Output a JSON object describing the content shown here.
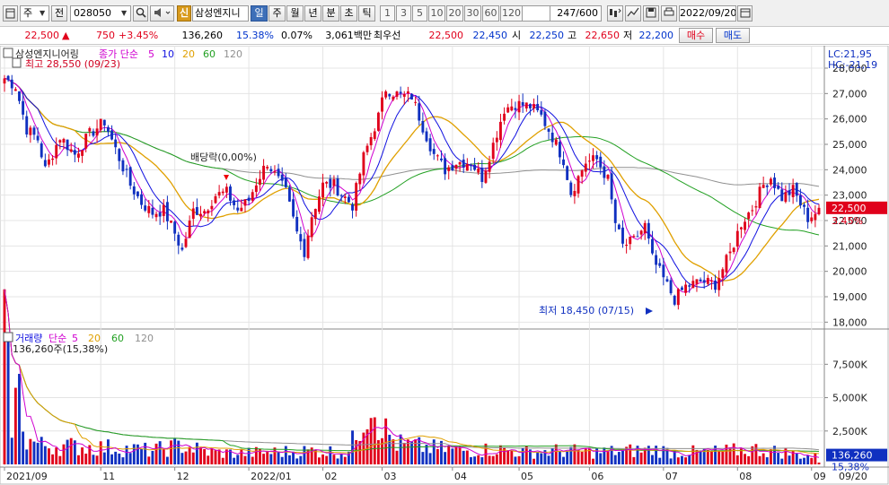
{
  "toolbar": {
    "market": "주",
    "prev_label": "전",
    "code": "028050",
    "sin_badge": "신",
    "stock_name": "삼성엔지니",
    "periods": [
      "일",
      "주",
      "월",
      "년",
      "분",
      "초",
      "틱"
    ],
    "selected_period": "일",
    "intervals": [
      "1",
      "3",
      "5",
      "10",
      "20",
      "30",
      "60",
      "120"
    ],
    "count": "247/600",
    "date": "2022/09/20"
  },
  "quote": {
    "price": "22,500",
    "change": "750",
    "change_pct": "+3.45%",
    "volume": "136,260",
    "volume_ratio": "15.38%",
    "turnover": "0.07%",
    "amount": "3,061백만",
    "best_label": "최우선",
    "best_ask": "22,500",
    "best_bid": "22,450",
    "open_label": "시",
    "open": "22,250",
    "high_label": "고",
    "high": "22,650",
    "low_label": "저",
    "low": "22,200",
    "buy_label": "매수",
    "sell_label": "매도"
  },
  "colors": {
    "up": "#e0001b",
    "down": "#1030c0",
    "ma5": "#d000d0",
    "ma10": "#1010e0",
    "ma20": "#e0a000",
    "ma60": "#22a022",
    "ma120": "#909090"
  },
  "chart_data": {
    "type": "candlestick",
    "price_panel": {
      "title": "삼성엔지니어링",
      "legend": [
        {
          "name": "종가 단순",
          "color": "#d000d0"
        },
        {
          "name": "5",
          "color": "#d000d0"
        },
        {
          "name": "10",
          "color": "#1010e0"
        },
        {
          "name": "20",
          "color": "#e0a000"
        },
        {
          "name": "60",
          "color": "#22a022"
        },
        {
          "name": "120",
          "color": "#909090"
        }
      ],
      "high_annotation": "최고 28,550 (09/23)",
      "low_annotation": "최저 18,450 (07/15)",
      "dividend_annotation": "배당락(0,00%)",
      "lc": "LC:21,95",
      "hc": "HC:-21,19",
      "current_price_label": "22,500",
      "current_pct_label": "3.45%",
      "ylim": [
        17800,
        28600
      ],
      "y_ticks": [
        18000,
        19000,
        20000,
        21000,
        22000,
        23000,
        24000,
        25000,
        26000,
        27000,
        28000
      ],
      "y_tick_labels": [
        "18,000",
        "19,000",
        "20,000",
        "21,000",
        "22,000",
        "23,000",
        "24,000",
        "25,000",
        "26,000",
        "27,000",
        "28,000"
      ],
      "close_anchors": [
        [
          0,
          27600
        ],
        [
          3,
          27300
        ],
        [
          6,
          25600
        ],
        [
          9,
          25200
        ],
        [
          11,
          24000
        ],
        [
          15,
          25300
        ],
        [
          19,
          24600
        ],
        [
          23,
          25400
        ],
        [
          27,
          25900
        ],
        [
          30,
          24800
        ],
        [
          34,
          23400
        ],
        [
          37,
          22700
        ],
        [
          40,
          22300
        ],
        [
          43,
          22400
        ],
        [
          46,
          21500
        ],
        [
          48,
          20800
        ],
        [
          51,
          22400
        ],
        [
          54,
          22400
        ],
        [
          57,
          23000
        ],
        [
          60,
          23100
        ],
        [
          63,
          22400
        ],
        [
          66,
          22800
        ],
        [
          68,
          23500
        ],
        [
          71,
          24300
        ],
        [
          73,
          23800
        ],
        [
          76,
          23100
        ],
        [
          79,
          21500
        ],
        [
          81,
          20800
        ],
        [
          83,
          22200
        ],
        [
          86,
          23400
        ],
        [
          89,
          23400
        ],
        [
          92,
          22900
        ],
        [
          94,
          22600
        ],
        [
          97,
          24500
        ],
        [
          101,
          26100
        ],
        [
          103,
          27200
        ],
        [
          107,
          26900
        ],
        [
          110,
          26900
        ],
        [
          113,
          25700
        ],
        [
          116,
          24600
        ],
        [
          119,
          24000
        ],
        [
          122,
          24300
        ],
        [
          126,
          24300
        ],
        [
          129,
          23700
        ],
        [
          132,
          25000
        ],
        [
          135,
          26400
        ],
        [
          138,
          26600
        ],
        [
          142,
          26500
        ],
        [
          145,
          26100
        ],
        [
          148,
          25300
        ],
        [
          151,
          24400
        ],
        [
          153,
          23100
        ],
        [
          157,
          24300
        ],
        [
          160,
          24400
        ],
        [
          163,
          23600
        ],
        [
          165,
          21900
        ],
        [
          167,
          21000
        ],
        [
          170,
          21200
        ],
        [
          173,
          21800
        ],
        [
          175,
          20500
        ],
        [
          178,
          19700
        ],
        [
          181,
          18900
        ],
        [
          184,
          19400
        ],
        [
          188,
          19600
        ],
        [
          192,
          19500
        ],
        [
          196,
          20700
        ],
        [
          199,
          21900
        ],
        [
          202,
          22500
        ],
        [
          205,
          23400
        ],
        [
          207,
          23700
        ],
        [
          210,
          22900
        ],
        [
          213,
          23200
        ],
        [
          217,
          22100
        ],
        [
          219,
          22300
        ],
        [
          220,
          22500
        ]
      ]
    },
    "volume_panel": {
      "legend": [
        {
          "name": "거래량",
          "color": "#1010e0"
        },
        {
          "name": "단순",
          "color": "#d000d0"
        },
        {
          "name": "5",
          "color": "#d000d0"
        },
        {
          "name": "20",
          "color": "#e0a000"
        },
        {
          "name": "60",
          "color": "#22a022"
        },
        {
          "name": "120",
          "color": "#909090"
        }
      ],
      "header_value": "136,260주(15,38%)",
      "current_volume_label": "136,260",
      "current_ratio_label": "15,38%",
      "ylim": [
        0,
        9000
      ],
      "y_ticks": [
        2500,
        5000,
        7500
      ],
      "y_tick_labels": [
        "2,500K",
        "5,000K",
        "7,500K"
      ],
      "volume_anchors": [
        [
          0,
          8700
        ],
        [
          2,
          3600
        ],
        [
          4,
          5200
        ],
        [
          6,
          1800
        ],
        [
          10,
          1400
        ],
        [
          20,
          1300
        ],
        [
          30,
          1200
        ],
        [
          40,
          1000
        ],
        [
          48,
          1400
        ],
        [
          55,
          900
        ],
        [
          63,
          800
        ],
        [
          73,
          900
        ],
        [
          83,
          1000
        ],
        [
          93,
          900
        ],
        [
          99,
          5200
        ],
        [
          101,
          3500
        ],
        [
          103,
          2400
        ],
        [
          106,
          1500
        ],
        [
          115,
          1200
        ],
        [
          125,
          1000
        ],
        [
          133,
          1100
        ],
        [
          140,
          900
        ],
        [
          150,
          1000
        ],
        [
          160,
          900
        ],
        [
          170,
          1000
        ],
        [
          176,
          1100
        ],
        [
          180,
          900
        ],
        [
          190,
          900
        ],
        [
          197,
          1000
        ],
        [
          203,
          1100
        ],
        [
          210,
          900
        ],
        [
          220,
          500
        ]
      ]
    },
    "x_ticks": [
      {
        "label": "2021/09",
        "index": 0
      },
      {
        "label": "11",
        "index": 26
      },
      {
        "label": "12",
        "index": 46
      },
      {
        "label": "2022/01",
        "index": 66
      },
      {
        "label": "02",
        "index": 86
      },
      {
        "label": "03",
        "index": 102
      },
      {
        "label": "04",
        "index": 121
      },
      {
        "label": "05",
        "index": 139
      },
      {
        "label": "06",
        "index": 158
      },
      {
        "label": "07",
        "index": 178
      },
      {
        "label": "08",
        "index": 198
      },
      {
        "label": "09",
        "index": 218
      }
    ],
    "right_date_label": "09/20",
    "bar_count": 221
  }
}
